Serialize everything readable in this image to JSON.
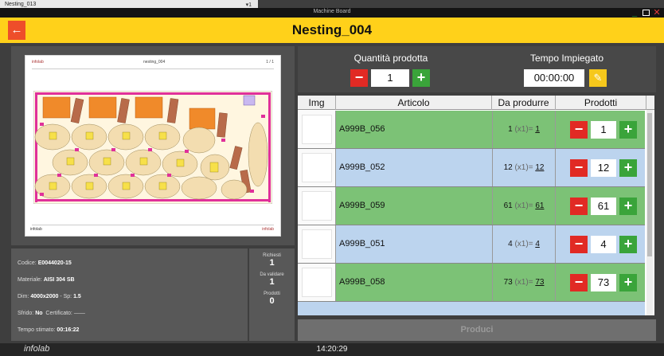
{
  "window": {
    "title": "Machine Board",
    "background_window": {
      "title": "Nesting_013",
      "counter": "▾1"
    }
  },
  "header": {
    "title": "Nesting_004",
    "back_icon": "arrow-left-icon"
  },
  "preview": {
    "brand_left": "infolab",
    "title": "nesting_004",
    "right_label": "1 / 1",
    "footer_brand": "infolab",
    "footer_right": "infolab"
  },
  "info": {
    "codice_label": "Codice:",
    "codice": "E0044020-15",
    "materiale_label": "Materiale:",
    "materiale": "AISI 304 SB",
    "dim_label": "Dim:",
    "dim": "4000x2000",
    "sp_label": "Sp:",
    "sp": "1.5",
    "sfrido_label": "Sfrido:",
    "sfrido": "No",
    "certificato_label": "Certificato:",
    "certificato": "——",
    "tempo_label": "Tempo stimato:",
    "tempo": "00:16:22"
  },
  "counts": {
    "richiesti_label": "Richiesti",
    "richiesti": "1",
    "da_validare_label": "Da validare",
    "da_validare": "1",
    "prodotti_label": "Prodotti",
    "prodotti": "0"
  },
  "controls": {
    "quantita_label": "Quantità prodotta",
    "quantita_value": "1",
    "tempo_label": "Tempo Impiegato",
    "tempo_value": "00:00:00"
  },
  "table": {
    "headers": {
      "img": "Img",
      "articolo": "Articolo",
      "da_produrre": "Da produrre",
      "prodotti": "Prodotti"
    },
    "rows": [
      {
        "articolo": "A999B_056",
        "qty": "1",
        "mult": "(x1)=",
        "total": "1",
        "prodotti": "1",
        "color": "#7cc276"
      },
      {
        "articolo": "A999B_052",
        "qty": "12",
        "mult": "(x1)=",
        "total": "12",
        "prodotti": "12",
        "color": "#bcd4ee"
      },
      {
        "articolo": "A999B_059",
        "qty": "61",
        "mult": "(x1)=",
        "total": "61",
        "prodotti": "61",
        "color": "#7cc276"
      },
      {
        "articolo": "A999B_051",
        "qty": "4",
        "mult": "(x1)=",
        "total": "4",
        "prodotti": "4",
        "color": "#bcd4ee"
      },
      {
        "articolo": "A999B_058",
        "qty": "73",
        "mult": "(x1)=",
        "total": "73",
        "prodotti": "73",
        "color": "#7cc276"
      }
    ]
  },
  "produce_button": "Produci",
  "status": {
    "logo": "infolab",
    "clock": "14:20:29"
  },
  "colors": {
    "header": "#ffd11a",
    "minus": "#e12a24",
    "plus": "#3aa43a",
    "row_green": "#7cc276",
    "row_blue": "#bcd4ee"
  }
}
